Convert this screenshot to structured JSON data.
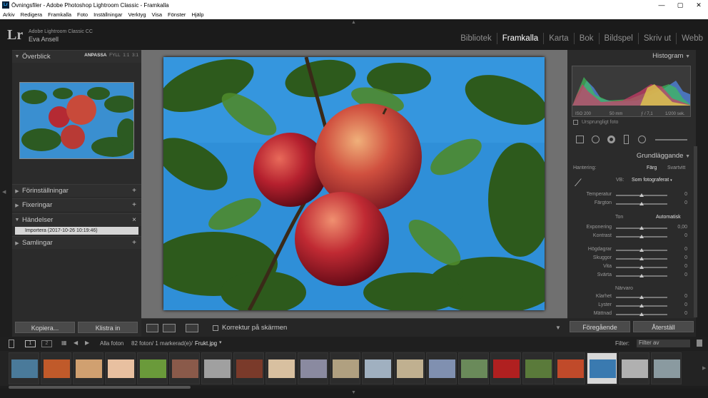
{
  "window": {
    "title": "Övningsfiler - Adobe Photoshop Lightroom Classic - Framkalla",
    "app_icon": "Lr",
    "minimize": "—",
    "maximize": "▢",
    "close": "✕"
  },
  "menu": [
    "Arkiv",
    "Redigera",
    "Framkalla",
    "Foto",
    "Inställningar",
    "Verktyg",
    "Visa",
    "Fönster",
    "Hjälp"
  ],
  "identity": {
    "logo": "Lr",
    "product": "Adobe Lightroom Classic CC",
    "user": "Eva Ansell"
  },
  "modules": [
    "Bibliotek",
    "Framkalla",
    "Karta",
    "Bok",
    "Bildspel",
    "Skriv ut",
    "Webb"
  ],
  "active_module": "Framkalla",
  "left_panel": {
    "navigator": {
      "title": "Överblick",
      "opt_fit": "ANPASSA",
      "opt_fill": "FYLL",
      "opt_1": "1:1",
      "opt_3": "3:1"
    },
    "presets": "Förinställningar",
    "snapshots": "Fixeringar",
    "history": "Händelser",
    "history_item": "Importera (2017-10-26 10:19:46)",
    "collections": "Samlingar",
    "copy_button": "Kopiera...",
    "paste_button": "Klistra in"
  },
  "toolbar": {
    "softproof": "Korrektur på skärmen"
  },
  "right_panel": {
    "histogram_title": "Histogram",
    "iso": "ISO 200",
    "focal": "50 mm",
    "aperture": "ƒ / 7,1",
    "shutter": "1/200 sek.",
    "original_photo": "Ursprungligt foto",
    "basic_title": "Grundläggande",
    "treatment": "Hantering:",
    "color": "Färg",
    "bw": "Svartvitt",
    "wb_label": "VB:",
    "wb_value": "Som fotograferat",
    "sliders_wb": [
      {
        "label": "Temperatur",
        "value": "0"
      },
      {
        "label": "Färgton",
        "value": "0"
      }
    ],
    "tone": "Ton",
    "auto": "Automatisk",
    "sliders_tone": [
      {
        "label": "Exponering",
        "value": "0,00"
      },
      {
        "label": "Kontrast",
        "value": "0"
      }
    ],
    "sliders_tone2": [
      {
        "label": "Högdagrar",
        "value": "0"
      },
      {
        "label": "Skuggor",
        "value": "0"
      },
      {
        "label": "Vita",
        "value": "0"
      },
      {
        "label": "Svärta",
        "value": "0"
      }
    ],
    "presence": "Närvaro",
    "sliders_presence": [
      {
        "label": "Klarhet",
        "value": "0"
      },
      {
        "label": "Lyster",
        "value": "0"
      },
      {
        "label": "Mättnad",
        "value": "0"
      }
    ],
    "prev_button": "Föregående",
    "reset_button": "Återställ"
  },
  "filmbar": {
    "page1": "1",
    "page2": "2",
    "source": "Alla foton",
    "count": "82 foton/ 1 markerad(e)/",
    "file": "Frukt.jpg",
    "filter_label": "Filter:",
    "filter_value": "Filter av"
  },
  "colors": {
    "active_module": "#ffffff",
    "inactive_module": "#8f8f8f",
    "sky": "#3a8fd0",
    "apple_red": "#c0283a"
  }
}
